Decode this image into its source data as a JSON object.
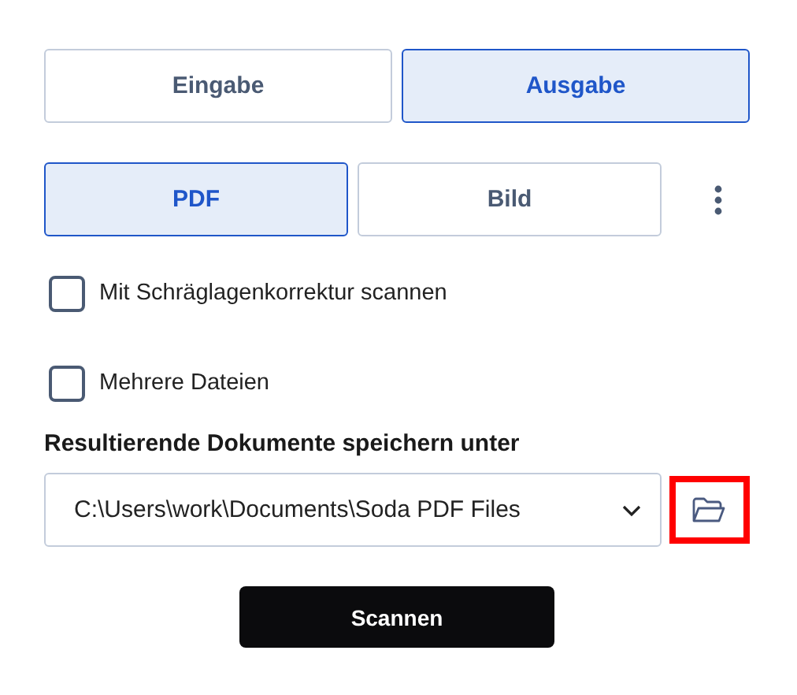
{
  "mode_tabs": [
    {
      "label": "Eingabe",
      "selected": false
    },
    {
      "label": "Ausgabe",
      "selected": true
    }
  ],
  "format_tabs": [
    {
      "label": "PDF",
      "selected": true
    },
    {
      "label": "Bild",
      "selected": false
    }
  ],
  "options": [
    {
      "label": "Mit Schräglagenkorrektur scannen",
      "checked": false
    },
    {
      "label": "Mehrere Dateien",
      "checked": false
    }
  ],
  "save_location": {
    "label": "Resultierende Dokumente speichern unter",
    "value": "C:\\Users\\work\\Documents\\Soda PDF Files",
    "browse_highlighted": true
  },
  "scan_button": "Scannen"
}
